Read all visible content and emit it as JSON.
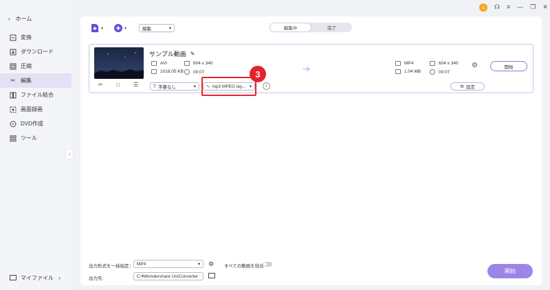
{
  "sidebar": {
    "home_label": "ホーム",
    "items": [
      {
        "label": "変換",
        "icon": "convert-icon"
      },
      {
        "label": "ダウンロード",
        "icon": "download-icon"
      },
      {
        "label": "圧縮",
        "icon": "compress-icon"
      },
      {
        "label": "編集",
        "icon": "scissors-icon"
      },
      {
        "label": "ファイル結合",
        "icon": "merge-icon"
      },
      {
        "label": "画面録画",
        "icon": "record-icon"
      },
      {
        "label": "DVD作成",
        "icon": "dvd-icon"
      },
      {
        "label": "ツール",
        "icon": "tools-icon"
      }
    ],
    "active_index": 3,
    "myfiles_label": "マイファイル"
  },
  "toolbar": {
    "mode_select": "編集",
    "tabs": [
      "編集中",
      "完了"
    ],
    "active_tab": 0
  },
  "file": {
    "name": "サンプル動画",
    "src": {
      "format": "AVI",
      "resolution": "604 x 340",
      "size": "1018.05 KB",
      "duration": "00:07"
    },
    "dst": {
      "format": "MP4",
      "resolution": "604 x 340",
      "size": "1.04 MB",
      "duration": "00:07"
    },
    "subtitle_select": "字幕なし",
    "audio_select": "mp3 MPEG lay...",
    "settings_label": "設定",
    "start_label": "開始"
  },
  "annotation": {
    "step_number": "3",
    "color": "#e5232e"
  },
  "footer": {
    "output_format_label": "出力形式を一括指定：",
    "output_format_value": "MP4",
    "merge_label": "すべての動画を結合",
    "output_path_label": "出力先:",
    "output_path_value": "C:¥Wondershare UniConverter 1",
    "start_all_label": "開始"
  },
  "colors": {
    "accent": "#9b86e8",
    "active_bg": "#e4e1f4"
  }
}
